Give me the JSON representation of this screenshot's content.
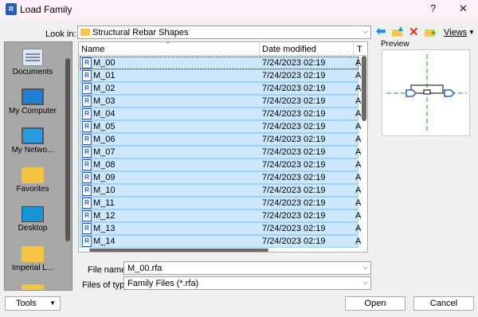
{
  "window": {
    "title": "Load Family",
    "app_icon": "R",
    "help": "?",
    "close": "✕"
  },
  "toolbar": {
    "look_in_label": "Look in:",
    "look_in_value": "Structural Rebar Shapes",
    "views_label": "Views",
    "icons": [
      "back-arrow-icon",
      "up-folder-icon",
      "delete-icon",
      "new-folder-icon",
      "views-icon"
    ]
  },
  "places": [
    {
      "label": "Documents",
      "icon": "documents-icon"
    },
    {
      "label": "My Computer",
      "icon": "computer-icon"
    },
    {
      "label": "My Netwo...",
      "icon": "network-icon"
    },
    {
      "label": "Favorites",
      "icon": "folder-icon"
    },
    {
      "label": "Desktop",
      "icon": "desktop-icon"
    },
    {
      "label": "Imperial L...",
      "icon": "folder-icon"
    }
  ],
  "file_list": {
    "columns": {
      "name": "Name",
      "date": "Date modified",
      "type": "T"
    },
    "rows": [
      {
        "name": "M_00",
        "date": "7/24/2023 02:19",
        "type": "A"
      },
      {
        "name": "M_01",
        "date": "7/24/2023 02:19",
        "type": "A"
      },
      {
        "name": "M_02",
        "date": "7/24/2023 02:19",
        "type": "A"
      },
      {
        "name": "M_03",
        "date": "7/24/2023 02:19",
        "type": "A"
      },
      {
        "name": "M_04",
        "date": "7/24/2023 02:19",
        "type": "A"
      },
      {
        "name": "M_05",
        "date": "7/24/2023 02:19",
        "type": "A"
      },
      {
        "name": "M_06",
        "date": "7/24/2023 02:19",
        "type": "A"
      },
      {
        "name": "M_07",
        "date": "7/24/2023 02:19",
        "type": "A"
      },
      {
        "name": "M_08",
        "date": "7/24/2023 02:19",
        "type": "A"
      },
      {
        "name": "M_09",
        "date": "7/24/2023 02:19",
        "type": "A"
      },
      {
        "name": "M_10",
        "date": "7/24/2023 02:19",
        "type": "A"
      },
      {
        "name": "M_11",
        "date": "7/24/2023 02:19",
        "type": "A"
      },
      {
        "name": "M_12",
        "date": "7/24/2023 02:19",
        "type": "A"
      },
      {
        "name": "M_13",
        "date": "7/24/2023 02:19",
        "type": "A"
      },
      {
        "name": "M_14",
        "date": "7/24/2023 02:19",
        "type": "A"
      }
    ]
  },
  "preview": {
    "label": "Preview"
  },
  "form": {
    "file_name_label": "File name:",
    "file_name_value": "M_00.rfa",
    "file_type_label": "Files of type:",
    "file_type_value": "Family Files (*.rfa)"
  },
  "buttons": {
    "tools": "Tools",
    "open": "Open",
    "cancel": "Cancel"
  },
  "colors": {
    "selection": "#cce8ff",
    "selection_border": "#99d1ff",
    "titlebar": "#fff0fa"
  }
}
